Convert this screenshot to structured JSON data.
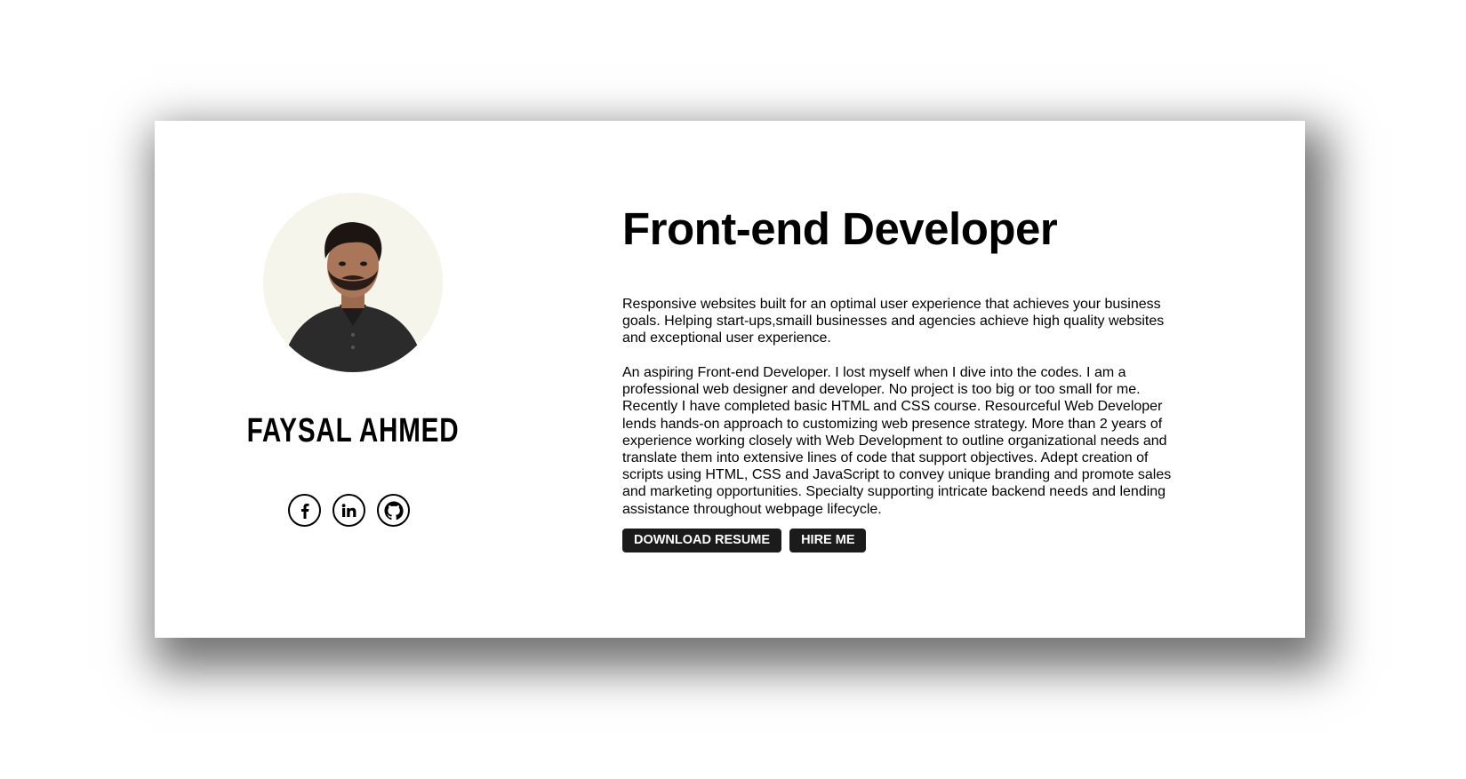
{
  "profile": {
    "name": "FAYSAL AHMED",
    "avatar_icon": "person-photo"
  },
  "social": [
    {
      "icon": "facebook-icon",
      "label": "f"
    },
    {
      "icon": "linkedin-icon",
      "label": "in"
    },
    {
      "icon": "github-icon",
      "label": ""
    }
  ],
  "content": {
    "title": "Front-end Developer",
    "paragraph1": "Responsive websites built for an optimal user experience that achieves your business goals. Helping start-ups,smaill businesses and agencies achieve high quality websites and exceptional user experience.",
    "paragraph2": "An aspiring Front-end Developer. I lost myself when I dive into the codes. I am a professional web designer and developer. No project is too big or too small for me. Recently I have completed basic HTML and CSS course. Resourceful Web Developer lends hands-on approach to customizing web presence strategy. More than 2 years of experience working closely with Web Development to outline organizational needs and translate them into extensive lines of code that support objectives. Adept creation of scripts using HTML, CSS and JavaScript to convey unique branding and promote sales and marketing opportunities. Specialty supporting intricate backend needs and lending assistance throughout webpage lifecycle."
  },
  "buttons": {
    "download_label": "DOWNLOAD RESUME",
    "hire_label": "HIRE ME"
  },
  "colors": {
    "button_bg": "#1b1b1b",
    "avatar_bg": "#f6f5ec",
    "text": "#000000"
  }
}
